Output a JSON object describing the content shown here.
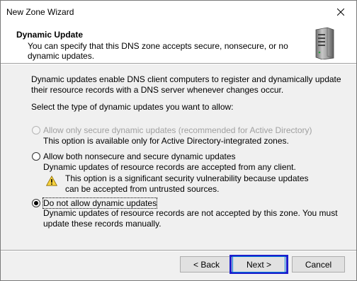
{
  "window": {
    "title": "New Zone Wizard",
    "accent_focus_color": "#1e1ecc"
  },
  "header": {
    "title": "Dynamic Update",
    "description": "You can specify that this DNS zone accepts secure, nonsecure, or no dynamic updates.",
    "icon": "server-icon"
  },
  "content": {
    "intro": "Dynamic updates enable DNS client computers to register and dynamically update their resource records with a DNS server whenever changes occur.",
    "prompt": "Select the type of dynamic updates you want to allow:",
    "options": [
      {
        "label": "Allow only secure dynamic updates (recommended for Active Directory)",
        "description": "This option is available only for Active Directory-integrated zones.",
        "selected": false,
        "enabled": false
      },
      {
        "label": "Allow both nonsecure and secure dynamic updates",
        "description": "Dynamic updates of resource records are accepted from any client.",
        "warning": "This option is a significant security vulnerability because updates can be accepted from untrusted sources.",
        "selected": false,
        "enabled": true
      },
      {
        "label": "Do not allow dynamic updates",
        "description": "Dynamic updates of resource records are not accepted by this zone. You must update these records manually.",
        "selected": true,
        "enabled": true
      }
    ]
  },
  "buttons": {
    "back": "< Back",
    "next": "Next >",
    "cancel": "Cancel"
  }
}
